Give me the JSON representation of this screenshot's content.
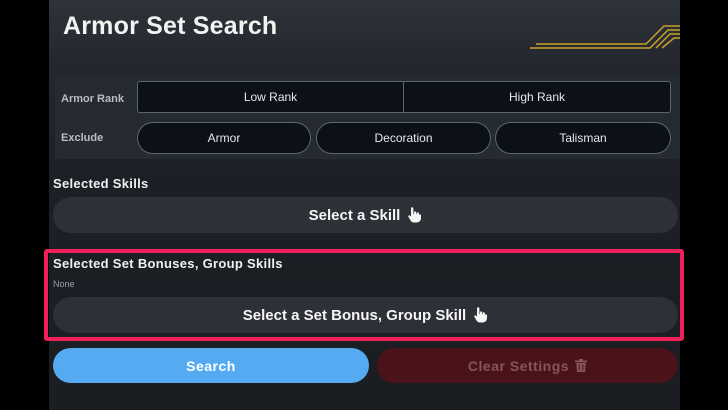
{
  "header": {
    "title": "Armor Set Search"
  },
  "filters": {
    "rank_label": "Armor Rank",
    "rank_options": [
      "Low Rank",
      "High Rank"
    ],
    "exclude_label": "Exclude",
    "exclude_options": [
      "Armor",
      "Decoration",
      "Talisman"
    ]
  },
  "skills": {
    "title": "Selected Skills",
    "button_label": "Select a Skill"
  },
  "set_bonuses": {
    "title": "Selected Set Bonuses, Group Skills",
    "status": "None",
    "button_label": "Select a Set Bonus, Group Skill"
  },
  "actions": {
    "search_label": "Search",
    "clear_label": "Clear Settings"
  },
  "colors": {
    "highlight": "#f0205a",
    "search_button": "#55aaf2",
    "clear_button": "#4a1319",
    "gold_accent": "#c9a227"
  },
  "icons": [
    "hand-pointer-icon",
    "trash-icon"
  ]
}
